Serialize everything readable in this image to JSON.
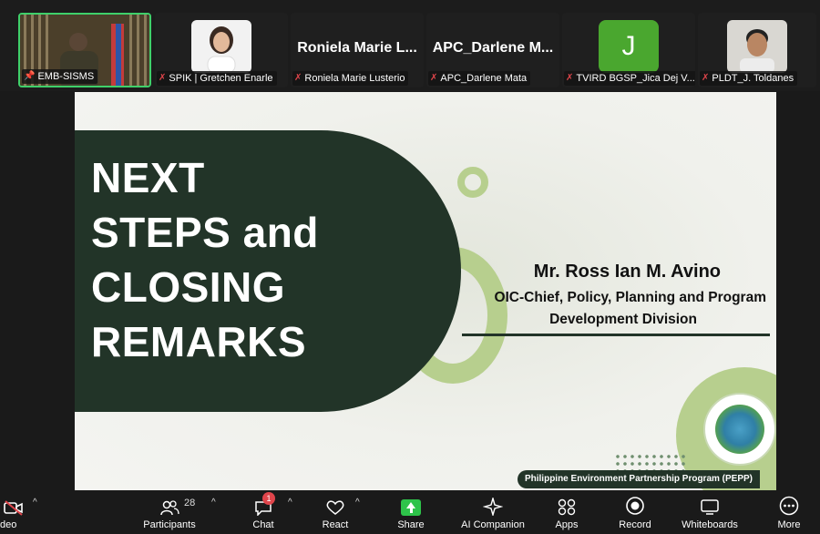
{
  "participants": [
    {
      "display_name": "EMB-SISMS",
      "muted": false,
      "pinned": true,
      "active": true
    },
    {
      "display_name": "SPIK | Gretchen Enarle",
      "muted": true
    },
    {
      "display_name": "Roniela Marie Lusterio",
      "muted": true,
      "big_label": "Roniela Marie L..."
    },
    {
      "display_name": "APC_Darlene Mata",
      "muted": true,
      "big_label": "APC_Darlene M..."
    },
    {
      "display_name": "TVIRD BGSP_Jica Dej V...",
      "muted": true,
      "avatar_letter": "J"
    },
    {
      "display_name": "PLDT_J. Toldanes",
      "muted": true
    }
  ],
  "slide": {
    "title_lines": [
      "NEXT",
      "STEPS and",
      "CLOSING",
      "REMARKS"
    ],
    "speaker_name": "Mr. Ross Ian M. Avino",
    "speaker_role_line1": "OIC-Chief, Policy, Planning and Program",
    "speaker_role_line2": "Development Division",
    "footer": "Philippine Environment Partnership Program (PEPP)",
    "colors": {
      "dark_green": "#223428",
      "light_green": "#b7cf8e"
    }
  },
  "toolbar": {
    "video_label": "deo",
    "participants_label": "Participants",
    "participants_count": "28",
    "chat_label": "Chat",
    "chat_badge": "1",
    "react_label": "React",
    "share_label": "Share",
    "ai_label": "AI Companion",
    "apps_label": "Apps",
    "record_label": "Record",
    "whiteboards_label": "Whiteboards",
    "more_label": "More"
  }
}
